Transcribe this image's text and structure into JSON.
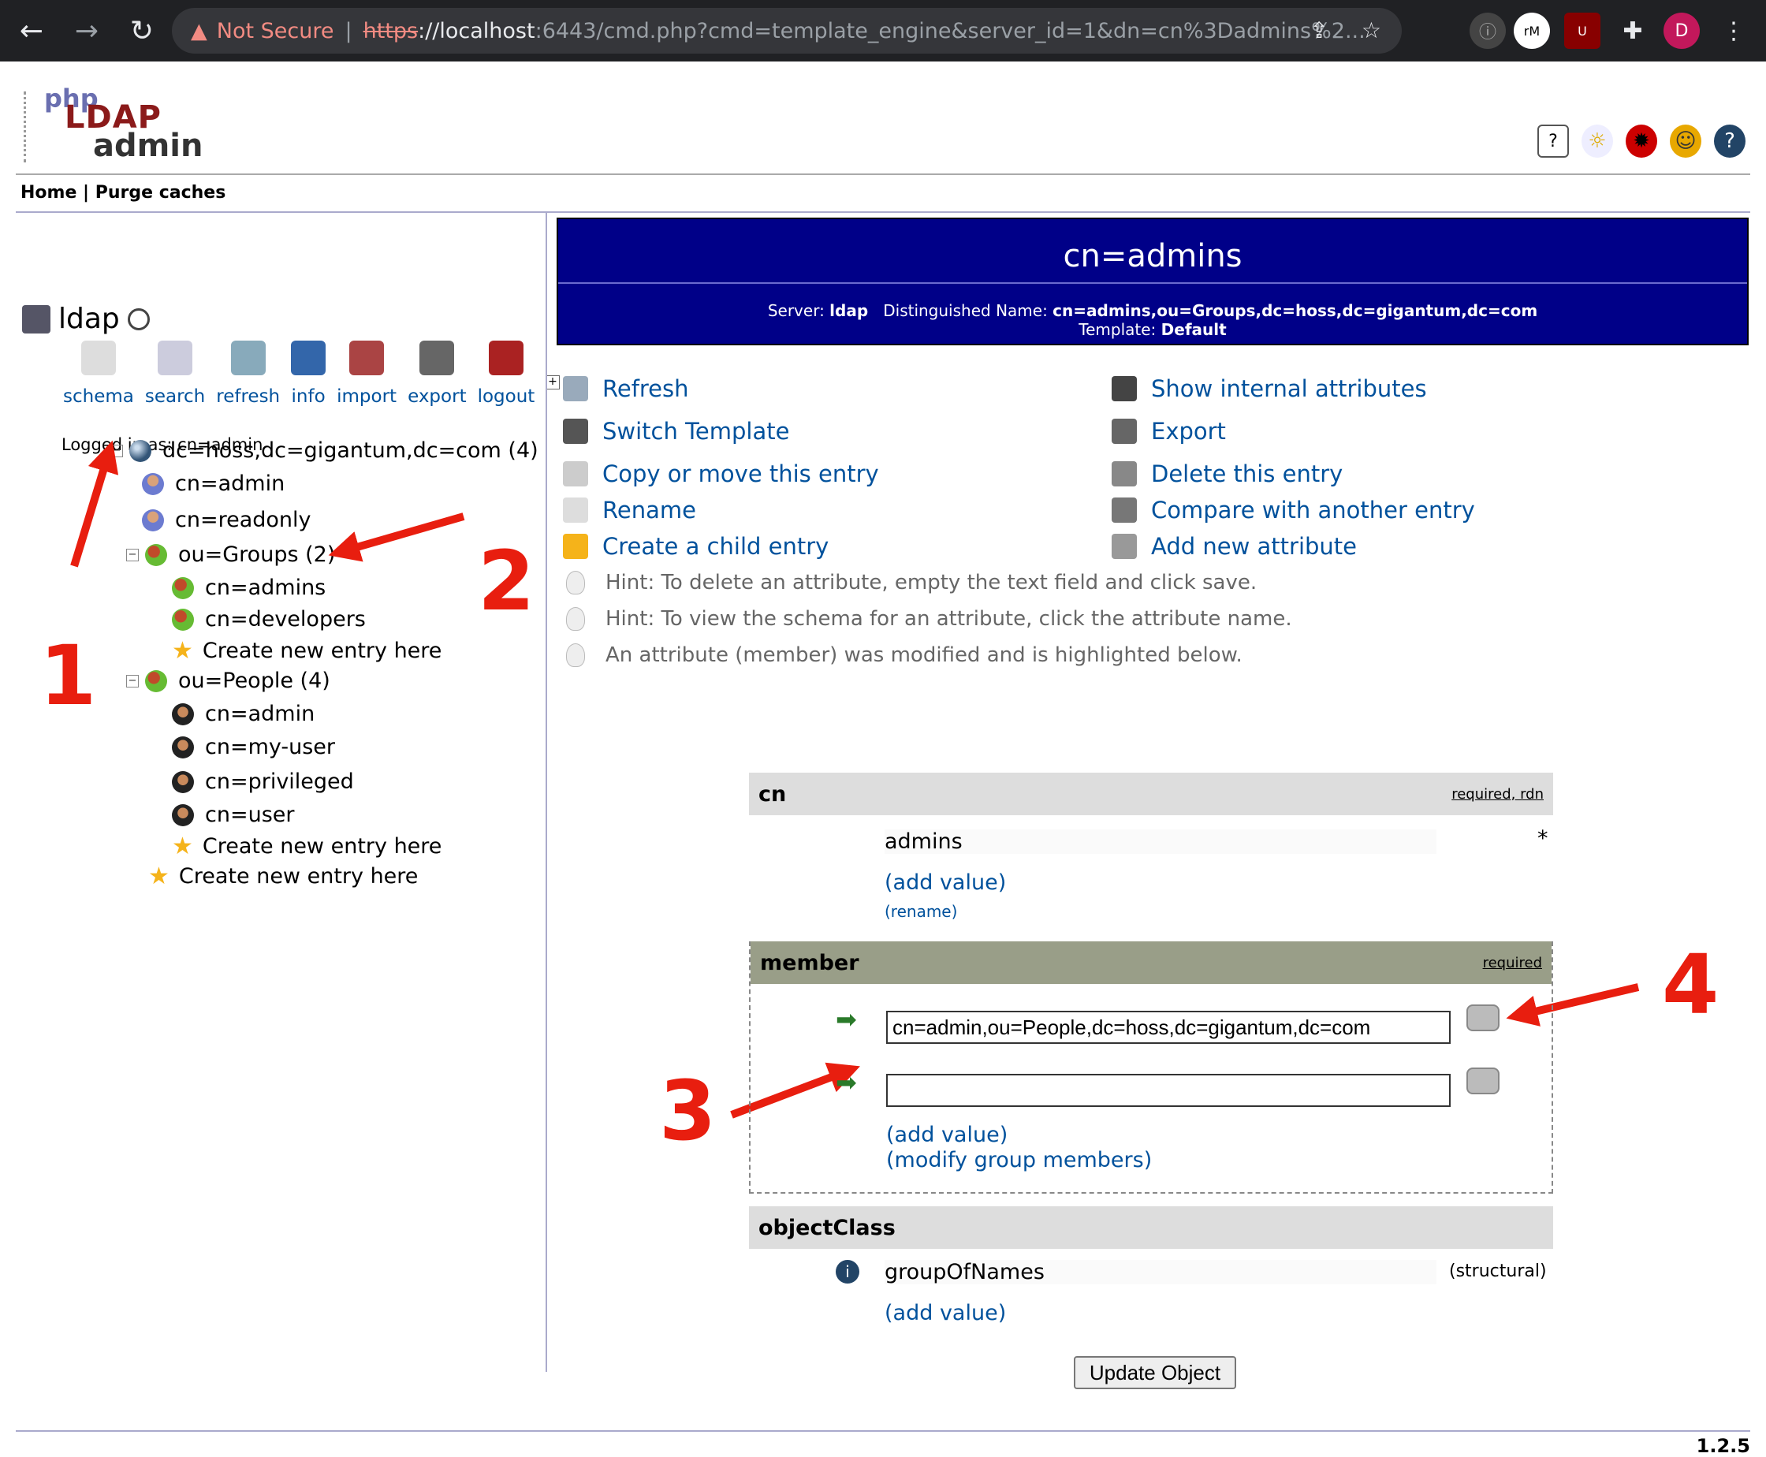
{
  "browser": {
    "back": "←",
    "forward": "→",
    "reload": "↻",
    "not_secure": "Not Secure",
    "url_proto": "https",
    "url_host": "://localhost",
    "url_rest": ":6443/cmd.php?cmd=template_engine&server_id=1&dn=cn%3Dadmins%2...",
    "profile": "D"
  },
  "app": {
    "logo_php": "php",
    "logo_ldap": "LDAP",
    "logo_admin": "admin",
    "menu": "Home | Purge caches",
    "version": "1.2.5"
  },
  "sidebar": {
    "server": "ldap",
    "tools": [
      "schema",
      "search",
      "refresh",
      "info",
      "import",
      "export",
      "logout"
    ],
    "logged_in": "Logged in as: cn=admin",
    "tree": [
      {
        "label": "dc=hoss,dc=gigantum,dc=com (4)",
        "kind": "root"
      },
      {
        "label": "cn=admin",
        "kind": "user"
      },
      {
        "label": "cn=readonly",
        "kind": "user"
      },
      {
        "label": "ou=Groups (2)",
        "kind": "ou"
      },
      {
        "label": "cn=admins",
        "kind": "group"
      },
      {
        "label": "cn=developers",
        "kind": "group"
      },
      {
        "label": "Create new entry here",
        "kind": "create"
      },
      {
        "label": "ou=People (4)",
        "kind": "ou"
      },
      {
        "label": "cn=admin",
        "kind": "person"
      },
      {
        "label": "cn=my-user",
        "kind": "person"
      },
      {
        "label": "cn=privileged",
        "kind": "person"
      },
      {
        "label": "cn=user",
        "kind": "person"
      },
      {
        "label": "Create new entry here",
        "kind": "create"
      },
      {
        "label": "Create new entry here",
        "kind": "create"
      }
    ]
  },
  "annotations": [
    "1",
    "2",
    "3",
    "4"
  ],
  "entry": {
    "title": "cn=admins",
    "server_label": "Server:",
    "server": "ldap",
    "dn_label": "Distinguished Name:",
    "dn": "cn=admins,ou=Groups,dc=hoss,dc=gigantum,dc=com",
    "template_label": "Template:",
    "template": "Default"
  },
  "actions": {
    "left": [
      "Refresh",
      "Switch Template",
      "Copy or move this entry",
      "Rename",
      "Create a child entry"
    ],
    "right": [
      "Show internal attributes",
      "Export",
      "Delete this entry",
      "Compare with another entry",
      "Add new attribute"
    ]
  },
  "hints": [
    "Hint: To delete an attribute, empty the text field and click save.",
    "Hint: To view the schema for an attribute, click the attribute name.",
    "An attribute (member) was modified and is highlighted below."
  ],
  "attributes": {
    "cn": {
      "name": "cn",
      "flags": "required, rdn",
      "value": "admins",
      "star": "*",
      "add": "(add value)",
      "rename": "(rename)"
    },
    "member": {
      "name": "member",
      "flags": "required",
      "values": [
        "cn=admin,ou=People,dc=hoss,dc=gigantum,dc=com",
        ""
      ],
      "add": "(add value)",
      "modify": "(modify group members)"
    },
    "objectClass": {
      "name": "objectClass",
      "value": "groupOfNames",
      "type": "(structural)",
      "add": "(add value)"
    }
  },
  "update_button": "Update Object"
}
